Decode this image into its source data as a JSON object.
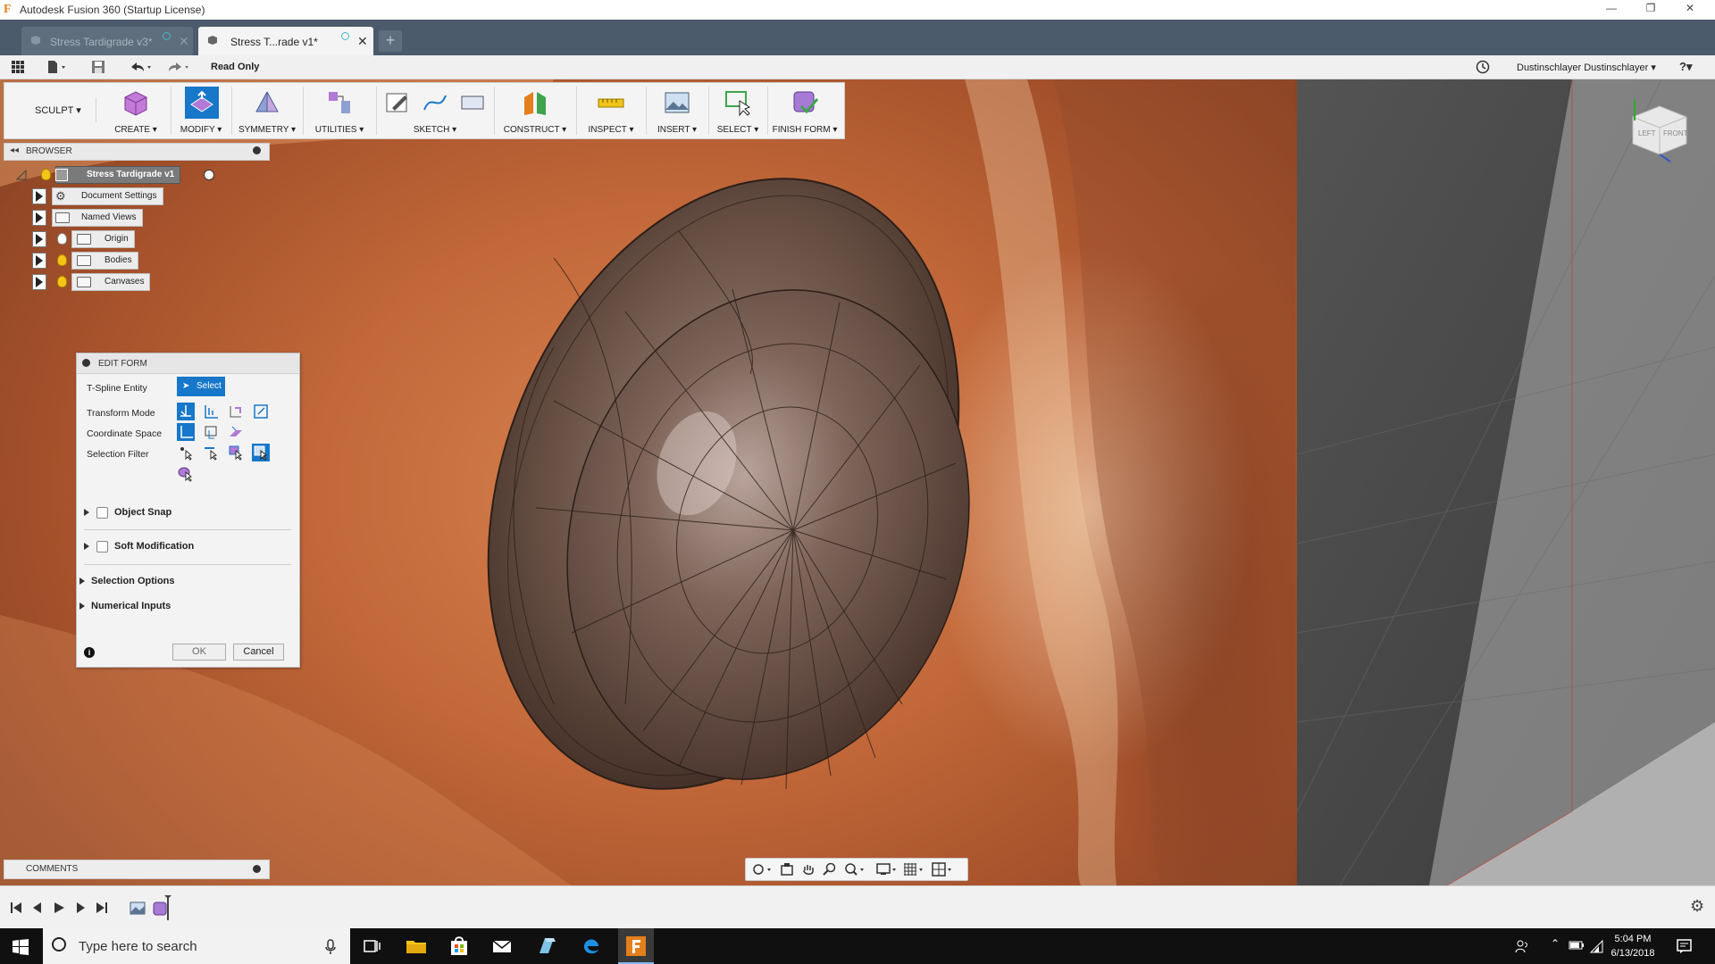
{
  "window": {
    "title": "Autodesk Fusion 360 (Startup License)",
    "min": "—",
    "max": "❐",
    "close": "✕"
  },
  "tabs": [
    {
      "label": "Stress Tardigrade v3*"
    },
    {
      "label": "Stress T...rade v1*"
    }
  ],
  "quickaccess": {
    "status": "Read Only",
    "user": "Dustinschlayer Dustinschlayer ▾",
    "help": "?▾"
  },
  "toolbar": {
    "workspace": "SCULPT ▾",
    "groups": [
      "CREATE ▾",
      "MODIFY ▾",
      "SYMMETRY ▾",
      "UTILITIES ▾",
      "SKETCH ▾",
      "CONSTRUCT ▾",
      "INSPECT ▾",
      "INSERT ▾",
      "SELECT ▾",
      "FINISH FORM ▾"
    ]
  },
  "browser": {
    "header": "BROWSER",
    "root": "Stress Tardigrade v1",
    "items": [
      "Document Settings",
      "Named Views",
      "Origin",
      "Bodies",
      "Canvases"
    ]
  },
  "editform": {
    "title": "EDIT FORM",
    "rows": {
      "tspline": "T-Spline Entity",
      "select": "Select",
      "transform": "Transform Mode",
      "coord": "Coordinate Space",
      "filter": "Selection Filter"
    },
    "sections": [
      "Object Snap",
      "Soft Modification",
      "Selection Options",
      "Numerical Inputs"
    ],
    "ok": "OK",
    "cancel": "Cancel"
  },
  "comments": {
    "label": "COMMENTS"
  },
  "viewcube": {
    "left": "LEFT",
    "front": "FRONT"
  },
  "taskbar": {
    "search": "Type here to search",
    "time": "5:04 PM",
    "date": "6/13/2018"
  },
  "colors": {
    "accent": "#1777c9",
    "tabbar": "#4b5b6b",
    "fusion_orange": "#e57f1b"
  }
}
